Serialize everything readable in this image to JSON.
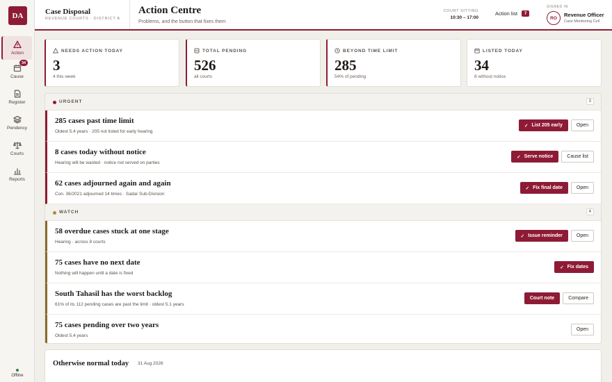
{
  "sidebar": {
    "logo": "DA",
    "items": [
      {
        "label": "Action"
      },
      {
        "label": "Cause",
        "badge": "34"
      },
      {
        "label": "Register"
      },
      {
        "label": "Pendency"
      },
      {
        "label": "Courts"
      },
      {
        "label": "Reports"
      }
    ],
    "status": "Offline"
  },
  "header": {
    "app_title": "Case Disposal",
    "app_subtitle": "REVENUE COURTS · DISTRICT A",
    "page_title": "Action Centre",
    "page_subtitle": "Problems, and the button that fixes them",
    "sitting_label": "COURT SITTING",
    "sitting_value": "10:30 – 17:00",
    "action_list_label": "Action list",
    "action_list_count": "7",
    "signed_in_label": "SIGNED IN",
    "avatar_initials": "RO",
    "user_name": "Revenue Officer",
    "user_role": "Case Monitoring Cell"
  },
  "stats": [
    {
      "label": "NEEDS ACTION TODAY",
      "value": "3",
      "sub": "4 this week"
    },
    {
      "label": "TOTAL PENDING",
      "value": "526",
      "sub": "all courts"
    },
    {
      "label": "BEYOND TIME LIMIT",
      "value": "285",
      "sub": "54% of pending"
    },
    {
      "label": "LISTED TODAY",
      "value": "34",
      "sub": "8 without notice"
    }
  ],
  "urgent": {
    "label": "URGENT",
    "count": "3",
    "rows": [
      {
        "title": "285 cases past time limit",
        "detail": "Oldest 5.4 years · 205 not listed for early hearing",
        "primary": "List 205 early",
        "secondary": "Open"
      },
      {
        "title": "8 cases today without notice",
        "detail": "Hearing will be wasted · notice not served on parties",
        "primary": "Serve notice",
        "secondary": "Cause list"
      },
      {
        "title": "62 cases adjourned again and again",
        "detail": "Con. 36/2021 adjourned 14 times · Sadar Sub-Division",
        "primary": "Fix final date",
        "secondary": "Open"
      }
    ]
  },
  "watch": {
    "label": "WATCH",
    "count": "4",
    "rows": [
      {
        "title": "58 overdue cases stuck at one stage",
        "detail": "Hearing · across 8 courts",
        "primary": "Issue reminder",
        "secondary": "Open"
      },
      {
        "title": "75 cases have no next date",
        "detail": "Nothing will happen until a date is fixed",
        "primary": "Fix dates"
      },
      {
        "title": "South Tahasil has the worst backlog",
        "detail": "61% of its 112 pending cases are past the limit · oldest 5.1 years",
        "primary": "Court note",
        "secondary": "Compare"
      },
      {
        "title": "75 cases pending over two years",
        "detail": "Oldest 5.4 years",
        "secondary": "Open"
      }
    ]
  },
  "normal": {
    "title": "Otherwise normal today",
    "date": "31 Aug 2026"
  },
  "colors": {
    "accent": "#8e1b35",
    "watch": "#8a6a2a",
    "ok": "#3b7a4a"
  }
}
